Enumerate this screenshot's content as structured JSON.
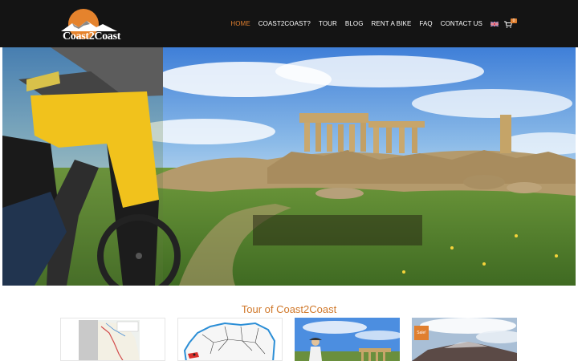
{
  "brand": {
    "name": "Coast2Coast"
  },
  "nav": {
    "items": [
      {
        "label": "HOME",
        "active": true
      },
      {
        "label": "COAST2COAST?"
      },
      {
        "label": "TOUR"
      },
      {
        "label": "BLOG"
      },
      {
        "label": "RENT A BIKE"
      },
      {
        "label": "FAQ"
      },
      {
        "label": "CONTACT US"
      }
    ],
    "language_icon": "uk-flag-icon",
    "cart_icon": "cart-icon",
    "cart_count": "0"
  },
  "hero": {
    "image": "mountain-biker-at-greek-temple-ruins"
  },
  "section": {
    "title": "Tour of Coast2Coast"
  },
  "cards": [
    {
      "image": "route-map-thumbnail"
    },
    {
      "image": "island-outline-map-thumbnail"
    },
    {
      "image": "cyclist-at-ruins-thumbnail"
    },
    {
      "image": "volcano-thumbnail",
      "badge": "Sale!"
    }
  ],
  "colors": {
    "accent": "#e07f2f",
    "header_bg": "#141414",
    "title": "#d0782a"
  }
}
